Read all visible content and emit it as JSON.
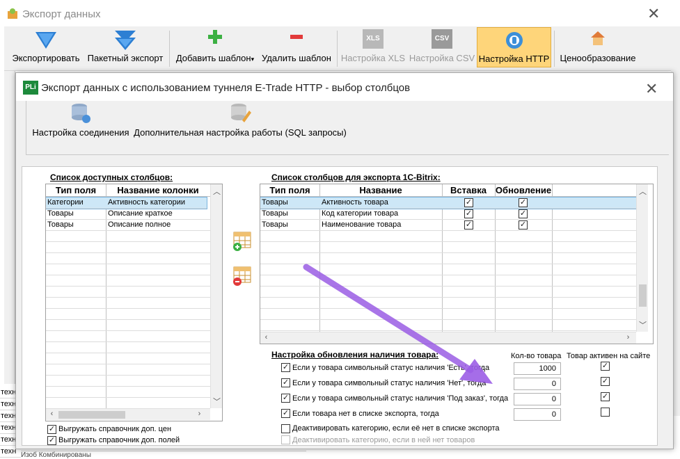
{
  "outer": {
    "title": "Экспорт данных",
    "toolbar": [
      {
        "label": "Экспортировать",
        "icon": "export-arrow-icon",
        "disabled": false
      },
      {
        "label": "Пакетный экспорт",
        "icon": "batch-export-icon",
        "disabled": false
      },
      {
        "label": "Добавить шаблон",
        "icon": "plus-icon",
        "disabled": false,
        "dropdown": "▾"
      },
      {
        "label": "Удалить шаблон",
        "icon": "minus-icon",
        "disabled": false
      },
      {
        "label": "Настройка XLS",
        "icon": "xls-icon",
        "disabled": true,
        "badge": "XLS"
      },
      {
        "label": "Настройка CSV",
        "icon": "csv-icon",
        "disabled": true,
        "badge": "CSV"
      },
      {
        "label": "Настройка HTTP",
        "icon": "http-icon",
        "disabled": false,
        "active": true
      },
      {
        "label": "Ценообразование",
        "icon": "pricing-icon",
        "disabled": false
      }
    ],
    "bg_rows": [
      "техн",
      "техн",
      "техн",
      "техн",
      "техн",
      "техн"
    ],
    "bg_bottom": "Изоб                                                 Комбинированы"
  },
  "dialog": {
    "icon_text": "PLi",
    "title": "Экспорт данных с использованием туннеля E-Trade HTTP - выбор столбцов",
    "toolbar": [
      {
        "label": "Настройка соединения",
        "icon": "database-connection-icon"
      },
      {
        "label": "Дополнительная настройка работы (SQL запросы)",
        "icon": "database-edit-icon"
      }
    ],
    "available": {
      "title": "Список доступных столбцов:",
      "headers": [
        "Тип поля",
        "Название колонки"
      ],
      "rows": [
        [
          "Категории",
          "Активность категории"
        ],
        [
          "Товары",
          "Описание краткое"
        ],
        [
          "Товары",
          "Описание полное"
        ]
      ]
    },
    "export_cols": {
      "title": "Список столбцов для экспорта 1С-Bitrix:",
      "headers": [
        "Тип поля",
        "Название",
        "Вставка",
        "Обновление"
      ],
      "rows": [
        {
          "type": "Товары",
          "name": "Активность товара",
          "insert": true,
          "update": true
        },
        {
          "type": "Товары",
          "name": "Код категории товара",
          "insert": true,
          "update": true
        },
        {
          "type": "Товары",
          "name": "Наименование товара",
          "insert": true,
          "update": true
        }
      ]
    },
    "options_left": [
      {
        "label": "Выгружать справочник доп. цен",
        "checked": true
      },
      {
        "label": "Выгружать справочник доп. полей",
        "checked": true
      }
    ],
    "stock": {
      "title": "Настройка обновления наличия товара:",
      "col_qty": "Кол-во товара",
      "col_active": "Товар активен на сайте",
      "rows": [
        {
          "label": "Если у товара символьный статус наличия 'Есть', тогда",
          "checked": true,
          "qty": "1000",
          "active": true
        },
        {
          "label": "Если у товара символьный статус наличия 'Нет', тогда",
          "checked": true,
          "qty": "0",
          "active": true
        },
        {
          "label": "Если у товара символьный статус наличия 'Под заказ', тогда",
          "checked": true,
          "qty": "0",
          "active": true
        },
        {
          "label": "Если товара нет в списке экспорта, тогда",
          "checked": true,
          "qty": "0",
          "active": false
        }
      ],
      "deactivate1": "Деактивировать категорию, если её нет в списке экспорта",
      "deactivate2": "Деактивировать категорию, если в ней нет товаров"
    }
  },
  "colors": {
    "accent_arrow": "#9b5de5",
    "active_btn": "#fed57a",
    "selection": "#cde7f7"
  }
}
